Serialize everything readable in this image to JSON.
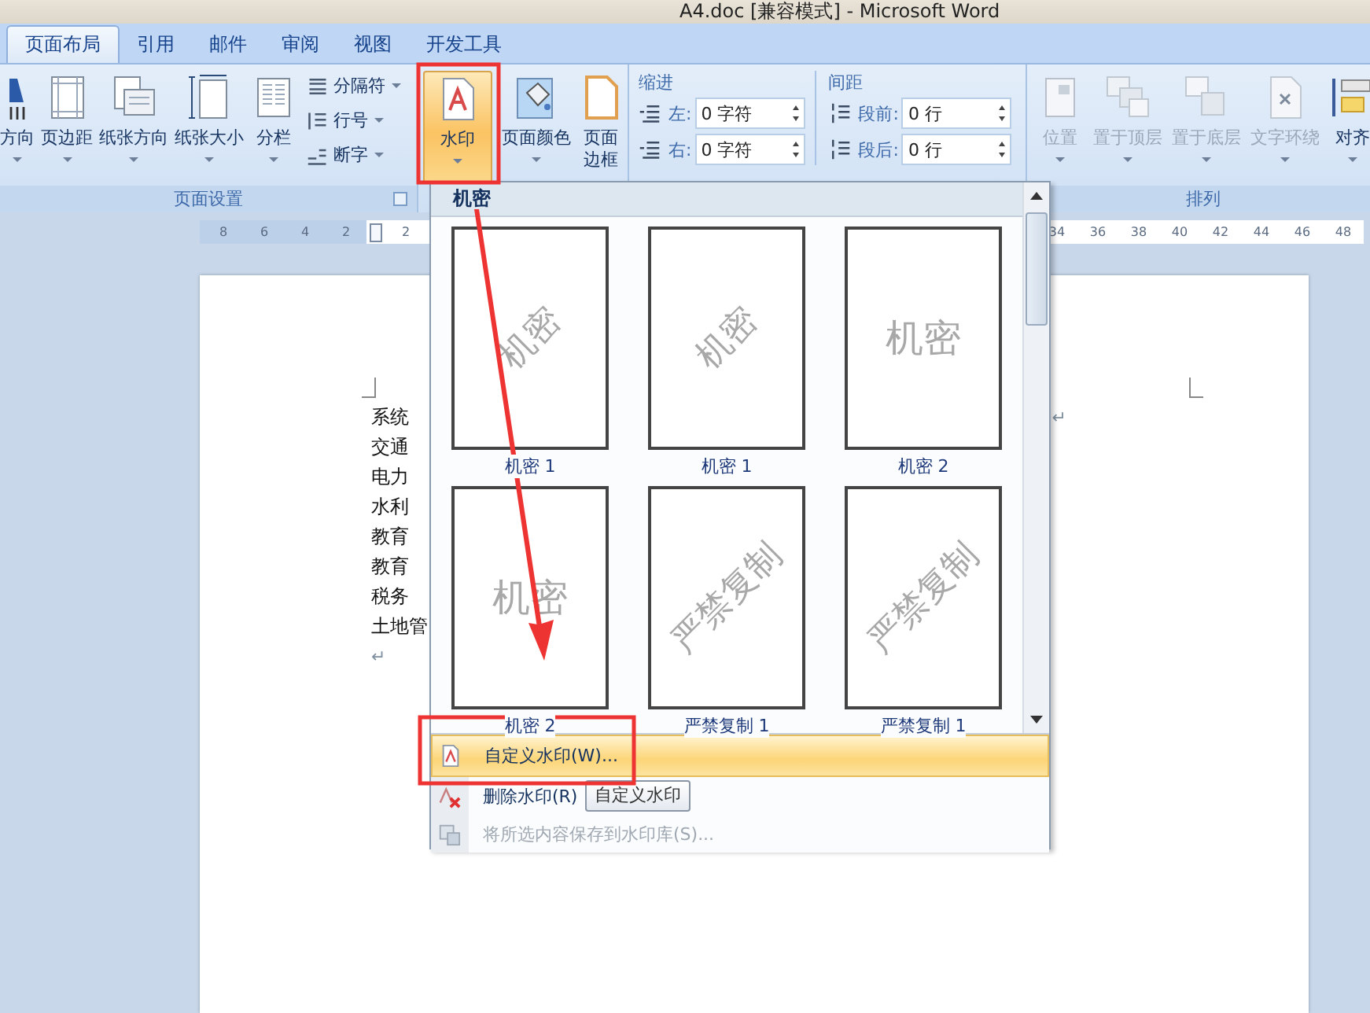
{
  "window": {
    "title": "A4.doc [兼容模式] - Microsoft Word"
  },
  "tabs": [
    {
      "label": "页面布局",
      "selected": true
    },
    {
      "label": "引用",
      "selected": false
    },
    {
      "label": "邮件",
      "selected": false
    },
    {
      "label": "审阅",
      "selected": false
    },
    {
      "label": "视图",
      "selected": false
    },
    {
      "label": "开发工具",
      "selected": false
    }
  ],
  "page_setup": {
    "label": "页面设置",
    "buttons": [
      {
        "label": "方向",
        "dropdown": true
      },
      {
        "label": "页边距",
        "dropdown": true
      },
      {
        "label": "纸张方向",
        "dropdown": true
      },
      {
        "label": "纸张大小",
        "dropdown": true
      },
      {
        "label": "分栏",
        "dropdown": true
      }
    ],
    "small_buttons": [
      {
        "label": "分隔符",
        "dropdown": true
      },
      {
        "label": "行号",
        "dropdown": true
      },
      {
        "label": "断字",
        "dropdown": true
      }
    ]
  },
  "page_background": {
    "buttons": [
      {
        "label": "水印",
        "pressed": true,
        "dropdown": true
      },
      {
        "label": "页面颜色",
        "pressed": false,
        "dropdown": true
      },
      {
        "label": "页面边框",
        "pressed": false,
        "dropdown": false
      }
    ]
  },
  "paragraph": {
    "indent": {
      "label": "缩进",
      "fields": [
        {
          "label": "左:",
          "value": "0 字符"
        },
        {
          "label": "右:",
          "value": "0 字符"
        }
      ]
    },
    "spacing": {
      "label": "间距",
      "fields": [
        {
          "label": "段前:",
          "value": "0 行"
        },
        {
          "label": "段后:",
          "value": "0 行"
        }
      ]
    }
  },
  "arrange": {
    "label": "排列",
    "buttons": [
      {
        "label": "位置",
        "disabled": true
      },
      {
        "label": "置于顶层",
        "disabled": true
      },
      {
        "label": "置于底层",
        "disabled": true
      },
      {
        "label": "文字环绕",
        "disabled": true
      },
      {
        "label": "对齐",
        "disabled": false
      }
    ]
  },
  "ruler": {
    "left_numbers": [
      "8",
      "6",
      "4",
      "2"
    ],
    "after_indent": [
      "2"
    ],
    "right_numbers": [
      "34",
      "36",
      "38",
      "40",
      "42",
      "44",
      "46",
      "48"
    ]
  },
  "document": {
    "lines": [
      "系统",
      "交通",
      "电力",
      "水利",
      "教育",
      "教育",
      "税务",
      "土地管",
      "↵"
    ],
    "side_mark": "↵"
  },
  "watermark_menu": {
    "heading": "机密",
    "gallery": [
      {
        "label": "机密 1",
        "mark": "机密",
        "kind": "diagonal"
      },
      {
        "label": "机密 1",
        "mark": "机密",
        "kind": "diagonal"
      },
      {
        "label": "机密 2",
        "mark": "机密",
        "kind": "horizontal"
      },
      {
        "label": "机密 2",
        "mark": "机密",
        "kind": "horizontal"
      },
      {
        "label": "严禁复制 1",
        "mark": "严禁复制",
        "kind": "diagonal"
      },
      {
        "label": "严禁复制 1",
        "mark": "严禁复制",
        "kind": "diagonal"
      }
    ],
    "items": [
      {
        "label": "自定义水印(W)...",
        "selected": true,
        "disabled": false
      },
      {
        "label": "删除水印(R)",
        "selected": false,
        "disabled": false
      },
      {
        "label": "将所选内容保存到水印库(S)...",
        "selected": false,
        "disabled": true
      }
    ],
    "tooltip": "自定义水印"
  }
}
